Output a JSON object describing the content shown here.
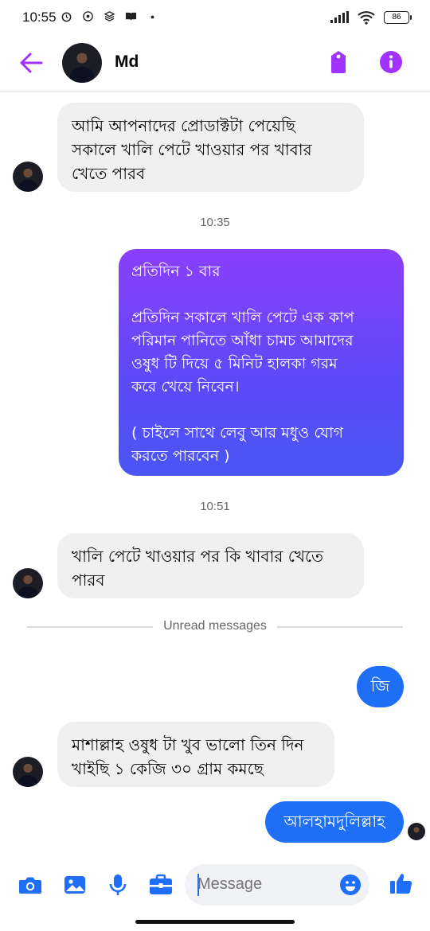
{
  "status_bar": {
    "time": "10:55",
    "battery": "86"
  },
  "header": {
    "contact_name": "Md"
  },
  "messages": [
    {
      "text": "আমি আপনাদের প্রোডাক্টটা পেয়েছি\nসকালে খালি পেটে খাওয়ার পর খাবার\nখেতে পারব"
    },
    {
      "text": "প্রতিদিন ১ বার\n\nপ্রতিদিন সকালে খালি পেটে এক কাপ\nপরিমান পানিতে আঁধা চামচ আমাদের\nওষুধ টি দিয়ে ৫ মিনিট হালকা গরম\nকরে খেয়ে নিবেন।\n\n( চাইলে সাথে লেবু আর মধুও যোগ\nকরতে পারবেন )"
    },
    {
      "text": "খালি পেটে খাওয়ার পর কি খাবার খেতে\nপারব"
    },
    {
      "text": "জি"
    },
    {
      "text": "মাশাল্লাহ ওষুধ টা খুব ভালো তিন দিন\nখাইছি ১ কেজি ৩০ গ্রাম কমছে"
    },
    {
      "text": "আলহামদুলিল্লাহ"
    }
  ],
  "timestamps": [
    "10:35",
    "10:51"
  ],
  "unread_label": "Unread messages",
  "composer": {
    "placeholder": "Message"
  },
  "colors": {
    "accent": "#a033ff",
    "blue": "#1e6ff5",
    "incoming_bubble": "#f0f0f0"
  },
  "icons": [
    "back-arrow-icon",
    "tag-icon",
    "info-icon",
    "camera-icon",
    "gallery-icon",
    "microphone-icon",
    "briefcase-icon",
    "emoji-icon",
    "thumbs-up-icon"
  ]
}
